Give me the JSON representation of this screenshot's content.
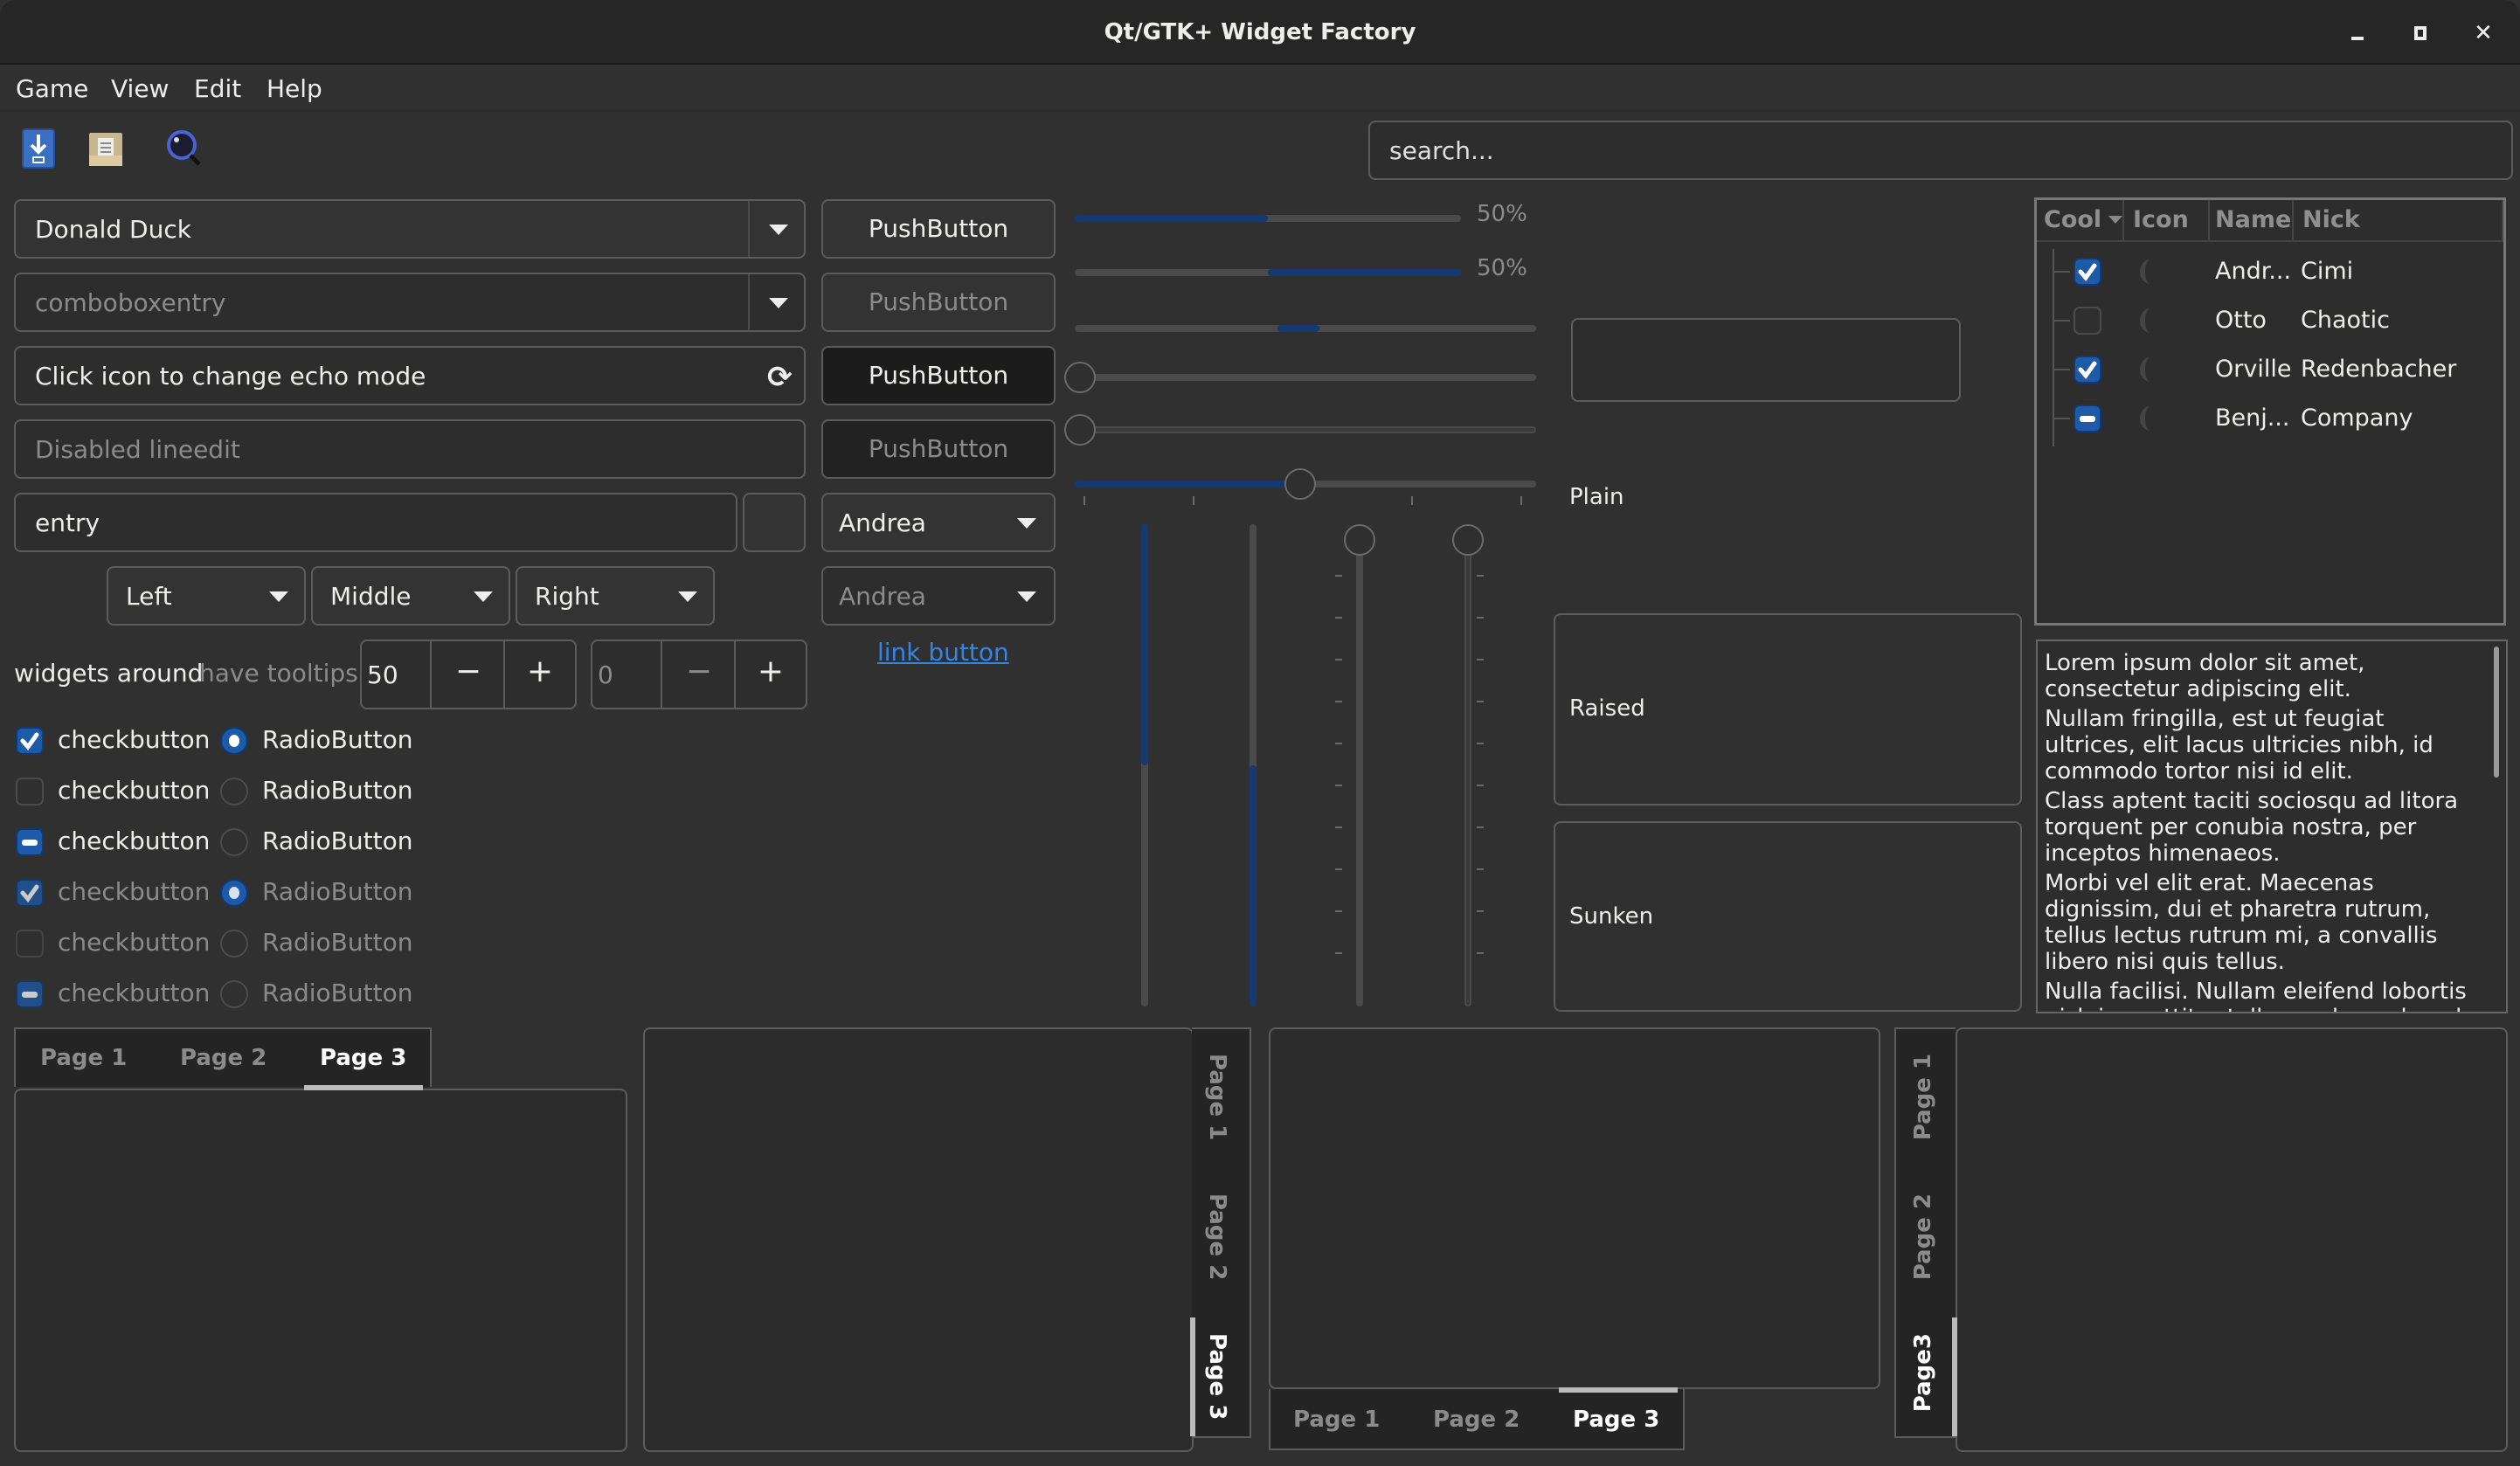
{
  "window": {
    "title": "Qt/GTK+ Widget Factory",
    "controls": {
      "minimize": "_",
      "maximize": "□",
      "close": "✕"
    }
  },
  "menubar": [
    "Game",
    "View",
    "Edit",
    "Help"
  ],
  "toolbar": {
    "icons": [
      "download-icon",
      "open-folder-icon",
      "find-icon"
    ],
    "search_placeholder": "search..."
  },
  "left": {
    "combobox": {
      "value": "Donald Duck"
    },
    "combobox_entry": {
      "placeholder": "comboboxentry"
    },
    "echo_entry": {
      "value": "Click icon to change echo mode",
      "icon": "refresh-icon"
    },
    "disabled_entry": {
      "placeholder": "Disabled lineedit"
    },
    "entry": {
      "value": "entry"
    },
    "align_combos": [
      "Left",
      "Middle",
      "Right"
    ],
    "tooltip_label_1": "widgets around",
    "tooltip_label_2": "have tooltips",
    "spin1": {
      "value": "50",
      "minus": "−",
      "plus": "+"
    },
    "spin2": {
      "value": "0",
      "minus": "−",
      "plus": "+"
    },
    "checks": [
      {
        "label": "checkbutton",
        "state": "checked",
        "enabled": true
      },
      {
        "label": "checkbutton",
        "state": "unchecked",
        "enabled": true
      },
      {
        "label": "checkbutton",
        "state": "mixed",
        "enabled": true
      },
      {
        "label": "checkbutton",
        "state": "checked",
        "enabled": false
      },
      {
        "label": "checkbutton",
        "state": "unchecked",
        "enabled": false
      },
      {
        "label": "checkbutton",
        "state": "mixed",
        "enabled": false
      }
    ],
    "radios": [
      {
        "label": "RadioButton",
        "state": "on",
        "enabled": true
      },
      {
        "label": "RadioButton",
        "state": "off",
        "enabled": true
      },
      {
        "label": "RadioButton",
        "state": "off",
        "enabled": true
      },
      {
        "label": "RadioButton",
        "state": "on",
        "enabled": false
      },
      {
        "label": "RadioButton",
        "state": "off",
        "enabled": false
      },
      {
        "label": "RadioButton",
        "state": "off",
        "enabled": false
      }
    ]
  },
  "buttons": {
    "push": [
      "PushButton",
      "PushButton",
      "PushButton",
      "PushButton"
    ],
    "combo1": "Andrea",
    "combo2": "Andrea",
    "link": "link button"
  },
  "progress": [
    {
      "value": 0.5,
      "label": "50%",
      "inverted": false
    },
    {
      "value": 0.5,
      "label": "50%",
      "inverted": true
    }
  ],
  "scales": {
    "h_slider_values": [
      0,
      0,
      0.5
    ],
    "v_progress": [
      {
        "value": 0.5,
        "inverted": true
      },
      {
        "value": 0.5,
        "inverted": false
      }
    ],
    "v_slider_values": [
      0,
      0
    ]
  },
  "frames": {
    "plain": "Plain",
    "raised": "Raised",
    "sunken": "Sunken"
  },
  "tree": {
    "headers": [
      "Cool",
      "Icon",
      "Name",
      "Nick"
    ],
    "rows": [
      {
        "cool": "checked",
        "name": "Andr...",
        "nick": "Cimi"
      },
      {
        "cool": "unchecked",
        "name": "Otto",
        "nick": "Chaotic"
      },
      {
        "cool": "checked",
        "name": "Orville",
        "nick": "Redenbacher"
      },
      {
        "cool": "mixed",
        "name": "Benj...",
        "nick": "Company"
      }
    ]
  },
  "textview": {
    "paragraphs": [
      "Lorem ipsum dolor sit amet, consectetur adipiscing elit.",
      "Nullam fringilla, est ut feugiat ultrices, elit lacus ultricies nibh, id commodo tortor nisi id elit.",
      "Class aptent taciti sociosqu ad litora torquent per conubia nostra, per inceptos himenaeos.",
      "Morbi vel elit erat. Maecenas dignissim, dui et pharetra rutrum, tellus lectus rutrum mi, a convallis libero nisi quis tellus.",
      "Nulla facilisi. Nullam eleifend lobortis nisl, in porttitor tellus malesuada vel."
    ]
  },
  "notebooks": [
    {
      "position": "top",
      "tabs": [
        "Page 1",
        "Page 2",
        "Page 3"
      ],
      "active": 2
    },
    {
      "position": "right",
      "tabs": [
        "Page 1",
        "Page 2",
        "Page 3"
      ],
      "active": 2
    },
    {
      "position": "bottom",
      "tabs": [
        "Page 1",
        "Page 2",
        "Page 3"
      ],
      "active": 2
    },
    {
      "position": "left",
      "tabs": [
        "Page 1",
        "Page 2",
        "Page3"
      ],
      "active": 2
    }
  ],
  "colors": {
    "accent": "#1d5aa8",
    "progress": "#15396e",
    "link": "#3584e4",
    "bg": "#303030"
  }
}
